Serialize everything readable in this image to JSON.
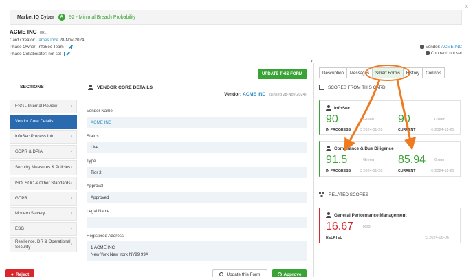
{
  "banner": {
    "title": "Market IQ Cyber",
    "badge": "A",
    "score_text": "92 - Minimal Breach Probability"
  },
  "close_icon": "×",
  "company": {
    "name": "ACME INC",
    "tag": "URL",
    "creator_label": "Card Creator:",
    "creator_name": "James Ince",
    "creator_date": "28-Nov-2024",
    "phase_owner": "Phase Owner: InfoSec Team",
    "phase_collaborator": "Phase Collaborator: not set",
    "vendor_label": "Vendor:",
    "vendor_name": "ACME INC",
    "contract": "Contract: not set"
  },
  "update_form_top": "UPDATE THIS FORM",
  "collapse_icon": "›",
  "sections": {
    "heading": "SECTIONS",
    "items": [
      {
        "label": "ESG - Internal Review",
        "active": false
      },
      {
        "label": "Vendor Core Details",
        "active": true
      },
      {
        "label": "InfoSec Process Info",
        "active": false
      },
      {
        "label": "GDPR & DPIA",
        "active": false
      },
      {
        "label": "Security Measures & Policies",
        "active": false
      },
      {
        "label": "ISO, SOC & Other Standards",
        "active": false
      },
      {
        "label": "GDPR",
        "active": false
      },
      {
        "label": "Modern Slavery",
        "active": false
      },
      {
        "label": "ESG",
        "active": false
      },
      {
        "label": "Resilience, DR & Operational Security",
        "active": false
      }
    ]
  },
  "form": {
    "heading": "VENDOR CORE DETAILS",
    "vendor_label": "Vendor:",
    "vendor_name": "ACME INC",
    "linked_text": "(Linked 28-Nov-2024)",
    "fields": {
      "vendor_name_label": "Vendor Name",
      "vendor_name_value": "ACME INC",
      "status_label": "Status",
      "status_value": "Live",
      "type_label": "Type",
      "type_value": "Tier 2",
      "approval_label": "Approval",
      "approval_value": "Approved",
      "legal_name_label": "Legal Name",
      "legal_name_value": "",
      "address_label": "Registered Address",
      "address_line1": "1 ACME INC",
      "address_line2": "New York New York NY99 99A"
    }
  },
  "buttons": {
    "reject": "Reject",
    "update_form": "Update this Form",
    "approve": "Approve"
  },
  "tabs": [
    "Description",
    "Messages",
    "Smart Forms",
    "History",
    "Controls"
  ],
  "active_tab": "Smart Forms",
  "scores": {
    "heading": "SCORES FROM THIS CARD",
    "cards": [
      {
        "title": "InfoSec",
        "left": {
          "value": "90",
          "word": "Green",
          "status": "IN PROGRESS",
          "date": "2024-11-28"
        },
        "right": {
          "value": "90",
          "word": "Green",
          "status": "CURRENT",
          "date": "2024-11-25"
        }
      },
      {
        "title": "Compliance & Due Diligence",
        "left": {
          "value": "91.5",
          "word": "Green",
          "status": "IN PROGRESS",
          "date": "2024-11-28"
        },
        "right": {
          "value": "85.94",
          "word": "Green",
          "status": "CURRENT",
          "date": "2024-11-25"
        }
      }
    ]
  },
  "related": {
    "heading": "RELATED SCORES",
    "card": {
      "title": "General Performance Management",
      "value": "16.67",
      "word": "Red",
      "status": "RELATED",
      "date": "2024-06-06"
    }
  },
  "colors": {
    "accent_green": "#3aa335",
    "accent_blue": "#2a6bb0",
    "link_blue": "#2e8bc0",
    "red": "#d9262b",
    "annotation_orange": "#f07a1f"
  }
}
